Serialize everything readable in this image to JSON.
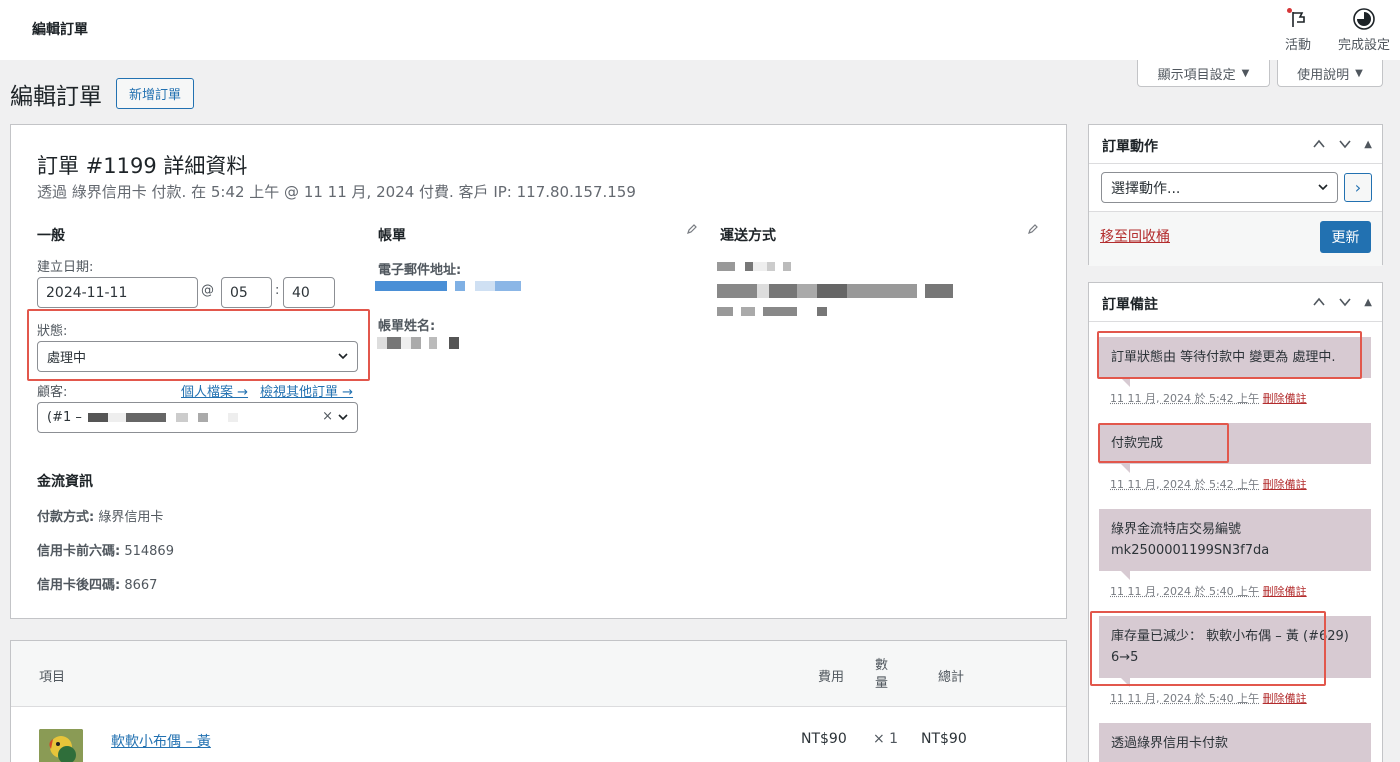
{
  "header": {
    "title": "編輯訂單",
    "activity_label": "活動",
    "finish_setup_label": "完成設定"
  },
  "screen_options": {
    "display_label": "顯示項目設定",
    "help_label": "使用說明"
  },
  "page": {
    "title": "編輯訂單",
    "add_new_label": "新增訂單"
  },
  "order": {
    "heading": "訂單 #1199 詳細資料",
    "subheading": "透過 綠界信用卡 付款. 在 5:42 上午 @ 11 11 月, 2024 付費. 客戶 IP: 117.80.157.159",
    "general": {
      "heading": "一般",
      "created_label": "建立日期:",
      "date_value": "2024-11-11",
      "at_sign": "@",
      "hour_value": "05",
      "colon": ":",
      "minute_value": "40",
      "status_label": "狀態:",
      "status_value": "處理中",
      "customer_label": "顧客:",
      "profile_link": "個人檔案 →",
      "other_orders_link": "檢視其他訂單 →",
      "customer_prefix": "(#1 –",
      "clear_symbol": "×"
    },
    "billing": {
      "heading": "帳單",
      "email_label": "電子郵件地址:",
      "name_label": "帳單姓名:"
    },
    "shipping": {
      "heading": "運送方式"
    },
    "payment": {
      "heading": "金流資訊",
      "method_label": "付款方式:",
      "method_value": "綠界信用卡",
      "first6_label": "信用卡前六碼:",
      "first6_value": "514869",
      "last4_label": "信用卡後四碼:",
      "last4_value": "8667"
    }
  },
  "items": {
    "col_item": "項目",
    "col_cost": "費用",
    "col_qty": "數量",
    "col_total": "總計",
    "rows": [
      {
        "name": "軟軟小布偶 – 黃",
        "cost": "NT$90",
        "qty": "× 1",
        "total": "NT$90"
      }
    ]
  },
  "order_actions": {
    "title": "訂單動作",
    "select_placeholder": "選擇動作...",
    "go_symbol": "›",
    "trash_link": "移至回收桶",
    "update_label": "更新"
  },
  "order_notes": {
    "title": "訂單備註",
    "delete_label": "刪除備註",
    "notes": [
      {
        "text": "訂單狀態由 等待付款中 變更為 處理中.",
        "date": "11 11 月, 2024 於 5:42 上午"
      },
      {
        "text": "付款完成",
        "date": "11 11 月, 2024 於 5:42 上午"
      },
      {
        "text": "綠界金流特店交易編號 mk2500001199SN3f7da",
        "date": "11 11 月, 2024 於 5:40 上午"
      },
      {
        "text": "庫存量已減少： 軟軟小布偶 – 黃 (#629) 6→5",
        "date": "11 11 月, 2024 於 5:40 上午"
      },
      {
        "text": "透過綠界信用卡付款",
        "date": ""
      }
    ]
  },
  "colors": {
    "accent": "#2271b1",
    "highlight_box": "#e2574c",
    "note_bg": "#d7cad2",
    "delete_red": "#b32d2e"
  }
}
